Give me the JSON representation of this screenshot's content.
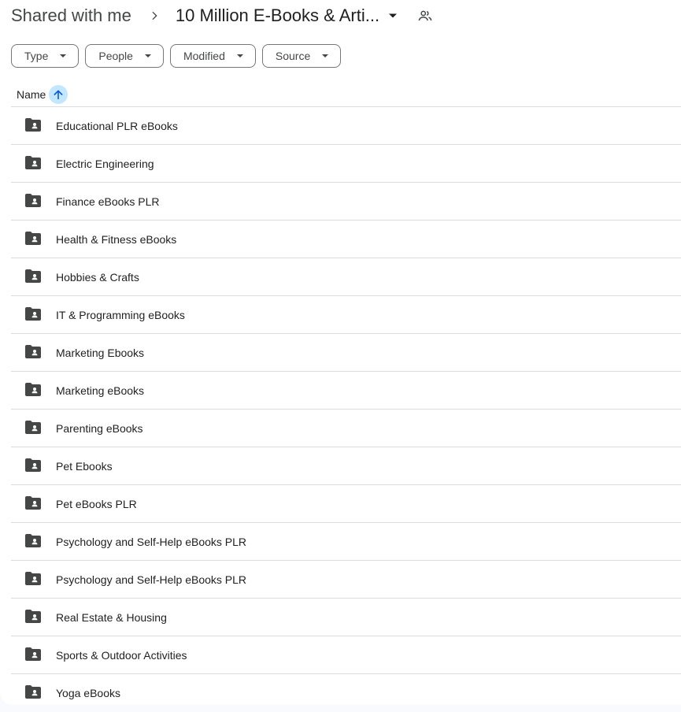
{
  "breadcrumb": {
    "root": "Shared with me",
    "current": "10 Million E-Books & Arti...",
    "icons": {
      "separator": "chevron-right-icon",
      "caret": "caret-down-icon",
      "shared": "people-icon"
    }
  },
  "filters": [
    {
      "label": "Type"
    },
    {
      "label": "People"
    },
    {
      "label": "Modified"
    },
    {
      "label": "Source"
    }
  ],
  "column_header": {
    "name": "Name",
    "sort_icon": "arrow-up-icon"
  },
  "colors": {
    "accent_sort_bg": "#c2e7ff",
    "accent_sort_fg": "#0b57d0",
    "icon": "#444746",
    "text": "#1f1f1f"
  },
  "items": [
    {
      "name": "Educational PLR eBooks"
    },
    {
      "name": "Electric Engineering"
    },
    {
      "name": "Finance eBooks PLR"
    },
    {
      "name": "Health & Fitness eBooks"
    },
    {
      "name": "Hobbies & Crafts"
    },
    {
      "name": "IT & Programming eBooks"
    },
    {
      "name": "Marketing Ebooks"
    },
    {
      "name": "Marketing eBooks"
    },
    {
      "name": "Parenting eBooks"
    },
    {
      "name": "Pet Ebooks"
    },
    {
      "name": "Pet eBooks PLR"
    },
    {
      "name": "Psychology and Self-Help eBooks PLR"
    },
    {
      "name": "Psychology and Self-Help eBooks PLR"
    },
    {
      "name": "Real Estate & Housing"
    },
    {
      "name": "Sports & Outdoor Activities"
    },
    {
      "name": "Yoga eBooks"
    }
  ]
}
